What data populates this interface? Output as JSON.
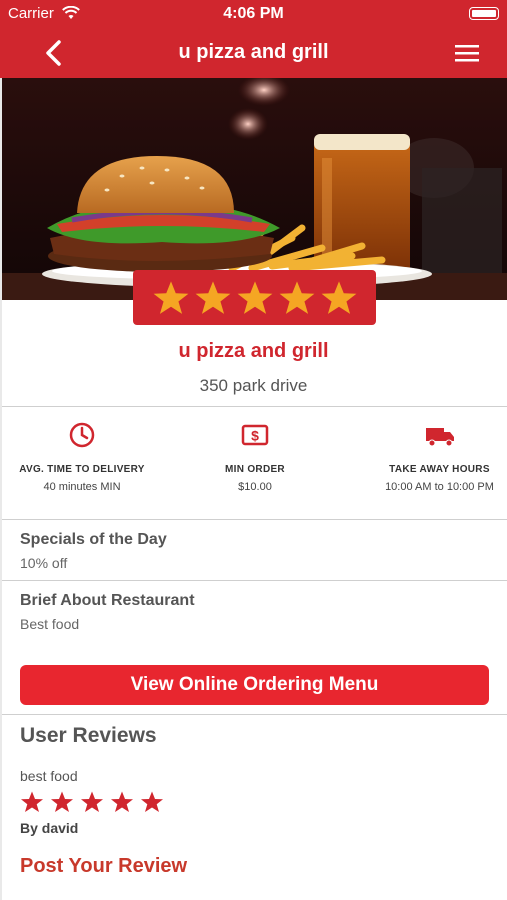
{
  "status_bar": {
    "carrier": "Carrier",
    "time": "4:06 PM"
  },
  "nav": {
    "title": "u pizza and grill",
    "back_icon": "chevron-left-icon",
    "menu_icon": "hamburger-menu-icon"
  },
  "restaurant": {
    "name": "u pizza and grill",
    "address": "350 park drive",
    "rating": 5,
    "rating_max": 5
  },
  "info": [
    {
      "icon": "clock-icon",
      "label": "AVG. TIME TO DELIVERY",
      "value": "40 minutes MIN"
    },
    {
      "icon": "dollar-bill-icon",
      "label": "MIN ORDER",
      "value": "$10.00"
    },
    {
      "icon": "delivery-truck-icon",
      "label": "TAKE AWAY HOURS",
      "value": "10:00 AM to 10:00 PM"
    }
  ],
  "specials": {
    "title": "Specials of the Day",
    "body": "10% off"
  },
  "brief": {
    "title": "Brief About Restaurant",
    "body": "Best food"
  },
  "menu_button": {
    "label": "View Online Ordering Menu"
  },
  "reviews": {
    "title": "User Reviews",
    "items": [
      {
        "text": "best food",
        "rating": 5,
        "author": "By david"
      }
    ]
  },
  "post_review": {
    "label": "Post Your Review"
  },
  "colors": {
    "brand_red": "#d0262e",
    "button_red": "#e8262f",
    "star_gold": "#f5a623"
  }
}
